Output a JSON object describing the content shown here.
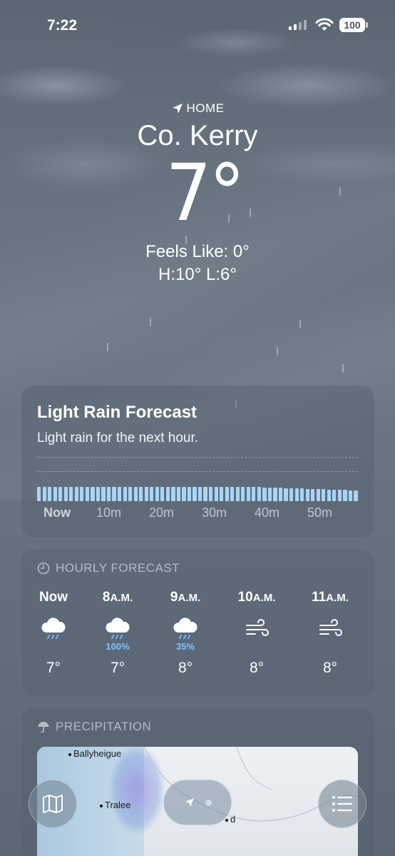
{
  "status_bar": {
    "time": "7:22",
    "battery": "100"
  },
  "location": {
    "label": "HOME",
    "city": "Co. Kerry"
  },
  "current": {
    "temperature": "7°",
    "feels_like": "Feels Like: 0°",
    "high_low": "H:10°  L:6°"
  },
  "rain_forecast": {
    "title": "Light Rain Forecast",
    "subtitle": "Light rain for the next hour.",
    "ticks": [
      "Now",
      "10m",
      "20m",
      "30m",
      "40m",
      "50m"
    ],
    "intensity_level": "light"
  },
  "hourly": {
    "header": "HOURLY FORECAST",
    "hours": [
      {
        "time": "Now",
        "suffix": "",
        "icon": "rain-cloud-icon",
        "chance": "",
        "temp": "7°"
      },
      {
        "time": "8",
        "suffix": "A.M.",
        "icon": "rain-cloud-icon",
        "chance": "100%",
        "temp": "7°"
      },
      {
        "time": "9",
        "suffix": "A.M.",
        "icon": "rain-cloud-icon",
        "chance": "35%",
        "temp": "8°"
      },
      {
        "time": "10",
        "suffix": "A.M.",
        "icon": "wind-icon",
        "chance": "",
        "temp": "8°"
      },
      {
        "time": "11",
        "suffix": "A.M.",
        "icon": "wind-icon",
        "chance": "",
        "temp": "8°"
      }
    ]
  },
  "precipitation": {
    "header": "PRECIPITATION",
    "places": {
      "ballyheigue": "Ballyheigue",
      "tralee": "Tralee",
      "partial": "d"
    }
  },
  "toolbar": {
    "map_icon": "map-icon",
    "location_icon": "location-arrow-icon",
    "list_icon": "list-icon"
  },
  "colors": {
    "rain_bar": "#a9d4f5",
    "chance_text": "#7ec3ff"
  }
}
